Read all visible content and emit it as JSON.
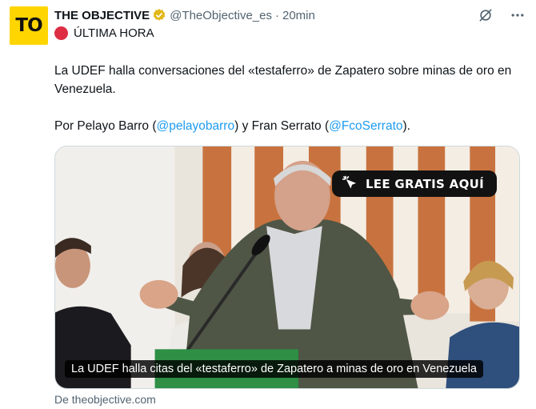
{
  "avatar": {
    "initials": "TO",
    "bg": "#ffd500"
  },
  "tweet": {
    "author_name": "THE OBJECTIVE",
    "handle": "@TheObjective_es",
    "separator": "·",
    "time": "20min",
    "verified_badge": "gold-verified-icon",
    "breaking_label": "ÚLTIMA HORA",
    "text": "La UDEF halla conversaciones del «testaferro» de Zapatero sobre minas de oro en Venezuela.",
    "byline_prefix": "Por Pelayo Barro (",
    "mention_1": "@pelayobarro",
    "byline_middle": ") y Fran Serrato (",
    "mention_2": "@FcoSerrato",
    "byline_suffix": ")."
  },
  "card": {
    "cta_label": "LEE GRATIS AQUÍ",
    "caption": "La UDEF halla citas del «testaferro» de Zapatero a minas de oro en Venezuela",
    "source": "De theobjective.com"
  },
  "colors": {
    "accent": "#1d9bf0",
    "text": "#0f1419",
    "muted": "#536471",
    "breaking": "#dd2e44"
  }
}
